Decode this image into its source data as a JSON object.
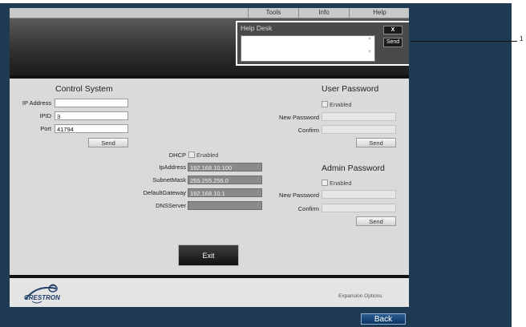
{
  "menu": [
    "Tools",
    "Info",
    "Help"
  ],
  "help_desk": {
    "title": "Help Desk",
    "close": "X",
    "send": "Send",
    "scroll_up": "▲",
    "scroll_down": "▼"
  },
  "control_system": {
    "title": "Control System",
    "ip_address_label": "IP Address",
    "ip_address_value": "",
    "ipid_label": "IPID",
    "ipid_value": "3",
    "port_label": "Port",
    "port_value": "41794",
    "send": "Send"
  },
  "network": {
    "dhcp_label": "DHCP",
    "dhcp_enabled_label": "Enabled",
    "ipaddress_label": "IpAddress",
    "ipaddress_value": "192.168.10.100",
    "subnetmask_label": "SubnetMask",
    "subnetmask_value": "255.255.255.0",
    "gateway_label": "DefaultGateway",
    "gateway_value": "192.168.10.1",
    "dns_label": "DNSServer",
    "dns_value": ""
  },
  "user_password": {
    "title": "User Password",
    "enabled_label": "Enabled",
    "new_label": "New Password",
    "confirm_label": "Confirm",
    "send": "Send"
  },
  "admin_password": {
    "title": "Admin Password",
    "enabled_label": "Enabled",
    "new_label": "New Password",
    "confirm_label": "Confirm",
    "send": "Send"
  },
  "exit": "Exit",
  "footer": {
    "logo_text": "CRESTRON",
    "expansion": "Expansion Options"
  },
  "back": "Back",
  "leader_label": "1",
  "colors": {
    "background": "#1f3b53",
    "panel": "#dadada",
    "back_button": "#1d4b80"
  }
}
